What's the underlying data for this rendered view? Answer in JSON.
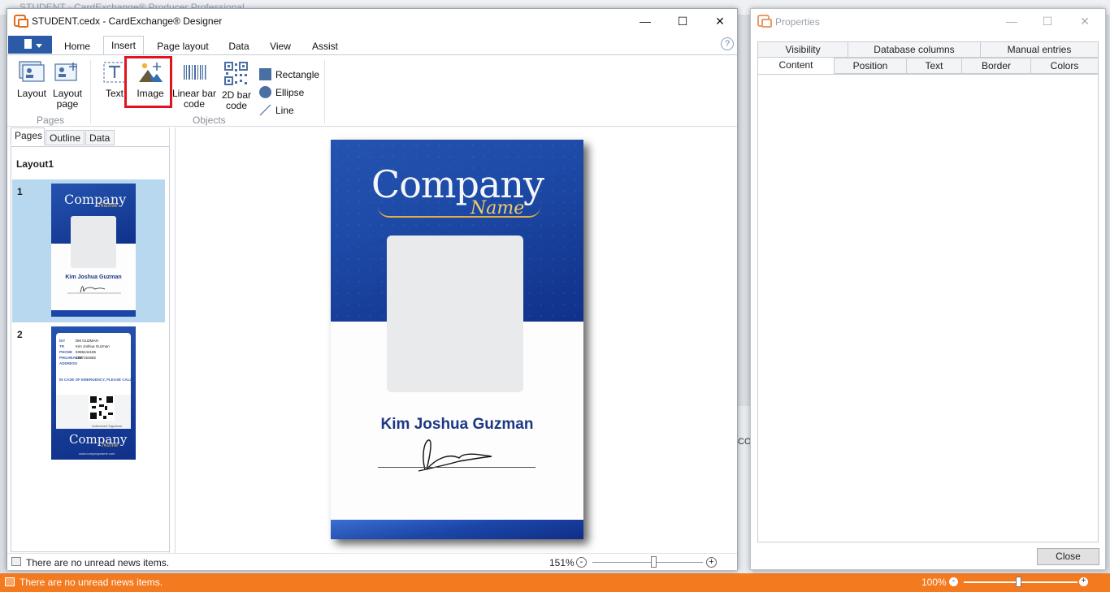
{
  "background": {
    "title": "STUDENT - CardExchange® Producer Professional",
    "status_news": "There are no unread news items.",
    "status_zoom": "100%",
    "side_text": "CON"
  },
  "main_window": {
    "title": "STUDENT.cedx - CardExchange® Designer",
    "controls": {
      "minimize": "—",
      "maximize": "☐",
      "close": "✕"
    },
    "ribbon_tabs": [
      "Home",
      "Insert",
      "Page layout",
      "Data",
      "View",
      "Assist"
    ],
    "active_tab": "Insert",
    "help": "?",
    "ribbon": {
      "pages_group": {
        "label": "Pages",
        "layout": "Layout",
        "layout_page_line1": "Layout",
        "layout_page_line2": "page"
      },
      "objects_group": {
        "label": "Objects",
        "text": "Text",
        "image": "Image",
        "linear_line1": "Linear bar",
        "linear_line2": "code",
        "barcode2d_line1": "2D bar",
        "barcode2d_line2": "code",
        "rectangle": "Rectangle",
        "ellipse": "Ellipse",
        "line": "Line"
      }
    },
    "left_panel": {
      "tabs": [
        "Pages",
        "Outline",
        "Data"
      ],
      "layout_title": "Layout1",
      "pages": [
        {
          "num": "1",
          "name": "Kim Joshua Guzman"
        },
        {
          "num": "2",
          "back_lines": [
            "DM GUZMAN",
            "Kim Joshua Guzman",
            "8365244185",
            "8367154682"
          ],
          "back_labels": [
            "ID#",
            "TR",
            "PHONE",
            "PHILHEALTH",
            "ADDRESS"
          ],
          "emergency": "IN CASE OF EMERGENCY, PLEASE CALL",
          "auth": "Authorized Signature",
          "website": "www.companyname.com"
        }
      ]
    },
    "card": {
      "company": "Company",
      "company_sub": "Name",
      "name": "Kim Joshua Guzman"
    },
    "status": {
      "news": "There are no unread news items.",
      "zoom": "151%",
      "zoom_minus": "-",
      "zoom_plus": "+"
    }
  },
  "properties_window": {
    "title": "Properties",
    "tabs_row1": [
      "Visibility",
      "Database columns",
      "Manual entries"
    ],
    "tabs_row2": [
      "Content",
      "Position",
      "Text",
      "Border",
      "Colors"
    ],
    "active_tab": "Content",
    "close_label": "Close"
  },
  "colors": {
    "accent_orange": "#f47a20",
    "card_blue": "#1d4aa6",
    "name_blue": "#1d3784",
    "highlight_red": "#e0141e"
  }
}
